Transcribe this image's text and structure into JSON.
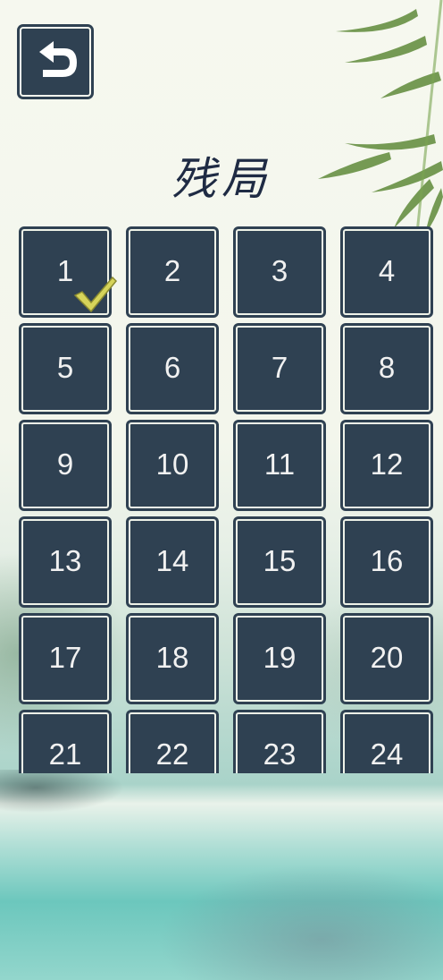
{
  "header": {
    "title": "残局",
    "back_icon": "back-arrow-icon"
  },
  "levels": [
    {
      "label": "1",
      "completed": true
    },
    {
      "label": "2",
      "completed": false
    },
    {
      "label": "3",
      "completed": false
    },
    {
      "label": "4",
      "completed": false
    },
    {
      "label": "5",
      "completed": false
    },
    {
      "label": "6",
      "completed": false
    },
    {
      "label": "7",
      "completed": false
    },
    {
      "label": "8",
      "completed": false
    },
    {
      "label": "9",
      "completed": false
    },
    {
      "label": "10",
      "completed": false
    },
    {
      "label": "11",
      "completed": false
    },
    {
      "label": "12",
      "completed": false
    },
    {
      "label": "13",
      "completed": false
    },
    {
      "label": "14",
      "completed": false
    },
    {
      "label": "15",
      "completed": false
    },
    {
      "label": "16",
      "completed": false
    },
    {
      "label": "17",
      "completed": false
    },
    {
      "label": "18",
      "completed": false
    },
    {
      "label": "19",
      "completed": false
    },
    {
      "label": "20",
      "completed": false
    },
    {
      "label": "21",
      "completed": false
    },
    {
      "label": "22",
      "completed": false
    },
    {
      "label": "23",
      "completed": false
    },
    {
      "label": "24",
      "completed": false
    }
  ],
  "colors": {
    "tile": "#2f4152",
    "text": "#f1f1f1",
    "check": "#d6d45a",
    "title": "#1f2b44"
  }
}
